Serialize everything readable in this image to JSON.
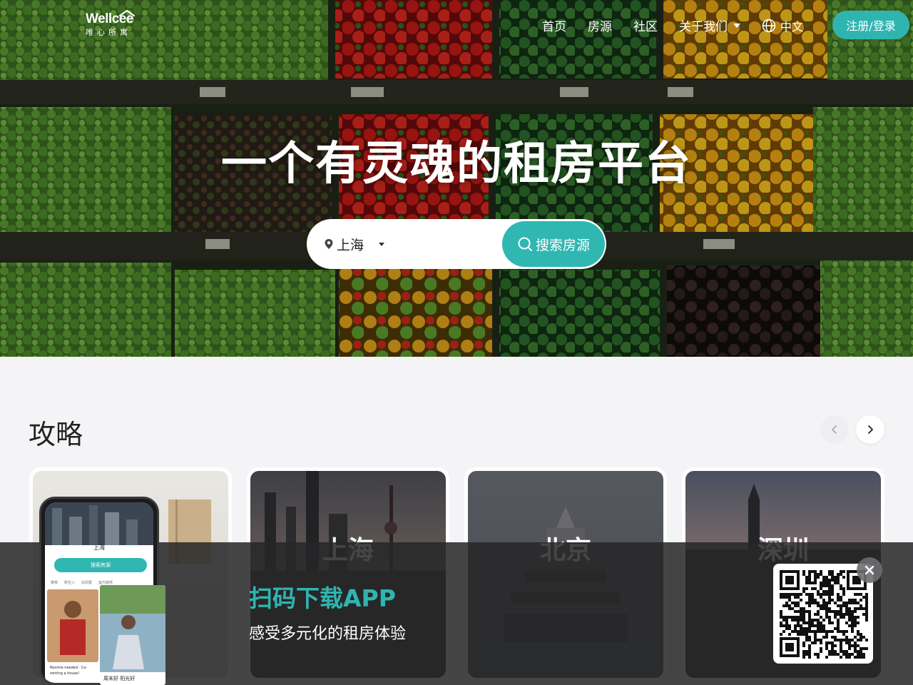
{
  "header": {
    "logo_brand": "Wellcee",
    "logo_sub": "唯心所寓",
    "nav": [
      "首页",
      "房源",
      "社区"
    ],
    "about": "关于我们",
    "language": "中文",
    "signin": "注册/登录"
  },
  "hero": {
    "title": "一个有灵魂的租房平台",
    "city": "上海",
    "search_button": "搜索房源"
  },
  "guides": {
    "title": "攻略",
    "cards": [
      {
        "label": ""
      },
      {
        "label": "上海"
      },
      {
        "label": "北京"
      },
      {
        "label": "深圳"
      }
    ]
  },
  "download_banner": {
    "title": "扫码下载APP",
    "subtitle": "感受多元化的租房体验",
    "phone": {
      "city": "上海",
      "search": "搜索房源",
      "tabs": [
        "推荐",
        "新空入",
        "出闲置",
        "室内装修"
      ],
      "post_text": "Roomie needed · Co-renting a house!",
      "post2_text": "周末好 阳光好"
    }
  },
  "colors": {
    "accent": "#30b7b2",
    "banner_bg": "#262628",
    "page_bg": "#f4f4f6"
  }
}
